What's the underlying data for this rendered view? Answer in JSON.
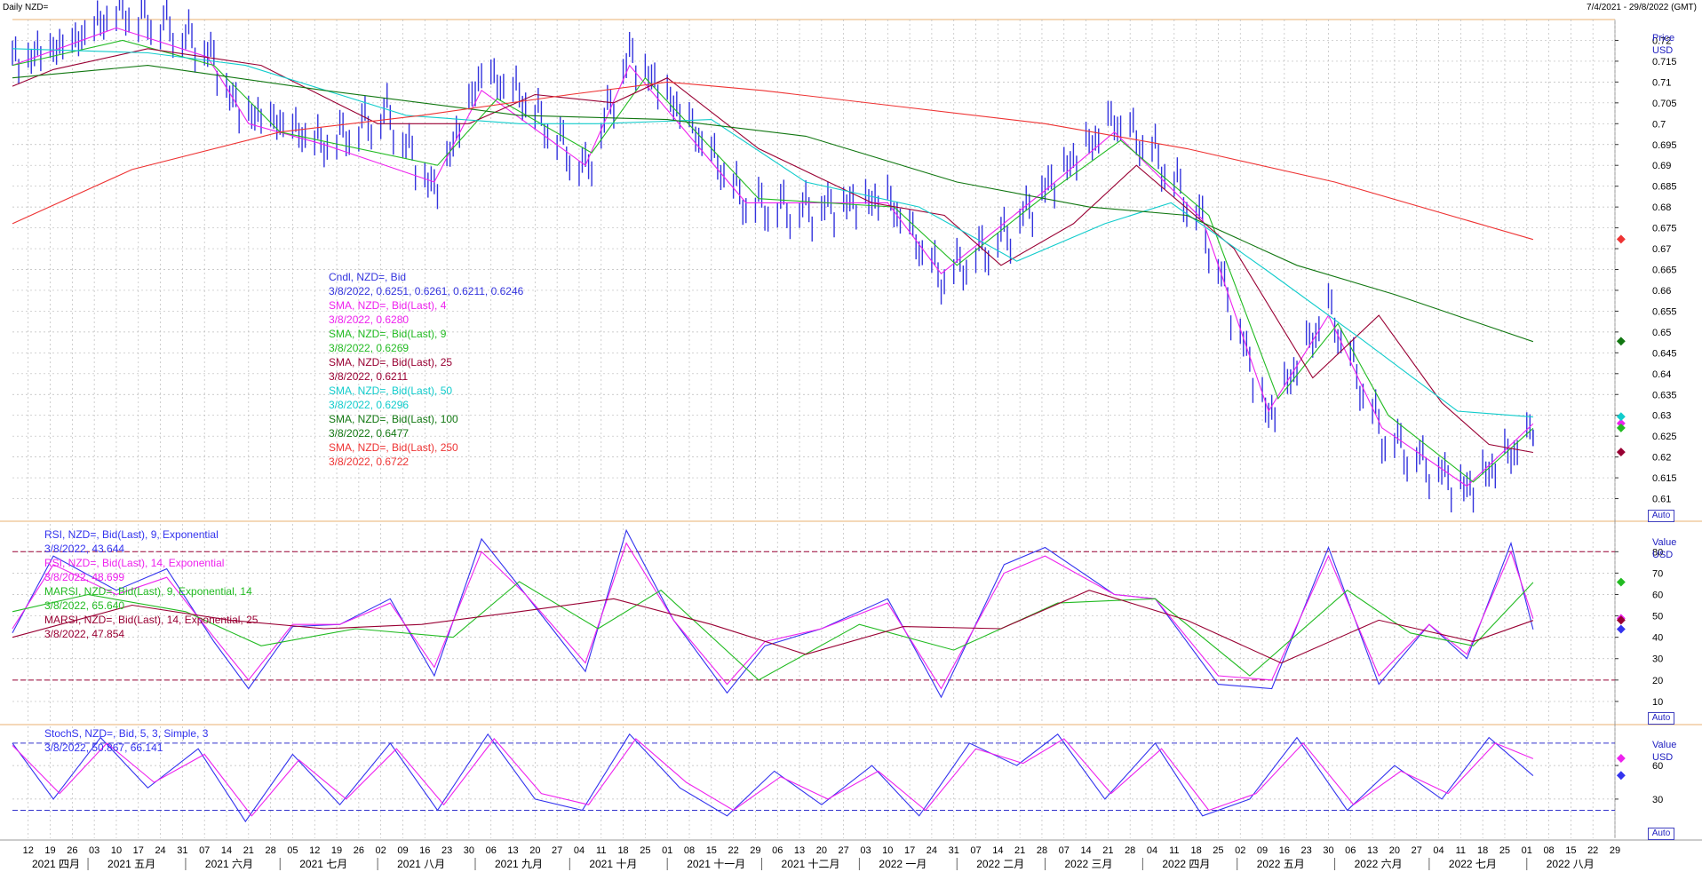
{
  "header": {
    "title": "Daily NZD=",
    "date_range": "7/4/2021 - 29/8/2022 (GMT)"
  },
  "colors": {
    "price": "#3333dd",
    "sma4": "#ee22ee",
    "sma9": "#22bb22",
    "sma25": "#990033",
    "sma50": "#11cccc",
    "sma100": "#117711",
    "sma250": "#ee3333",
    "rsi9": "#3333ee",
    "rsi14": "#ee22ee",
    "marsi9": "#22bb22",
    "marsi14": "#990033",
    "stoch_k": "#3333ee",
    "stoch_d": "#ee22ee",
    "grid": "#bbbbbb",
    "refline_rsi": "#990033",
    "refline_stoch": "#3333cc"
  },
  "main_panel": {
    "axis_title": "Price",
    "axis_unit": "USD",
    "auto_label": "Auto",
    "legend": [
      {
        "title": "Cndl, NZD=, Bid",
        "value": "3/8/2022, 0.6251, 0.6261, 0.6211, 0.6246",
        "color": "#3333dd"
      },
      {
        "title": "SMA, NZD=, Bid(Last),  4",
        "value": "3/8/2022, 0.6280",
        "color": "#ee22ee"
      },
      {
        "title": "SMA, NZD=, Bid(Last),  9",
        "value": "3/8/2022, 0.6269",
        "color": "#22bb22"
      },
      {
        "title": "SMA, NZD=, Bid(Last),  25",
        "value": "3/8/2022, 0.6211",
        "color": "#990033"
      },
      {
        "title": "SMA, NZD=, Bid(Last),  50",
        "value": "3/8/2022, 0.6296",
        "color": "#11cccc"
      },
      {
        "title": "SMA, NZD=, Bid(Last),  100",
        "value": "3/8/2022, 0.6477",
        "color": "#117711"
      },
      {
        "title": "SMA, NZD=, Bid(Last),  250",
        "value": "3/8/2022, 0.6722",
        "color": "#ee3333"
      }
    ]
  },
  "rsi_panel": {
    "axis_title": "Value",
    "axis_unit": "USD",
    "auto_label": "Auto",
    "legend": [
      {
        "title": "RSI, NZD=, Bid(Last),  9, Exponential",
        "value": "3/8/2022, 43.644",
        "color": "#3333ee"
      },
      {
        "title": "RSI, NZD=, Bid(Last),  14, Exponential",
        "value": "3/8/2022, 48.699",
        "color": "#ee22ee"
      },
      {
        "title": "MARSI, NZD=, Bid(Last),  9, Exponential, 14",
        "value": "3/8/2022, 65.640",
        "color": "#22bb22"
      },
      {
        "title": "MARSI, NZD=, Bid(Last),  14, Exponential, 25",
        "value": "3/8/2022, 47.854",
        "color": "#990033"
      }
    ]
  },
  "stoch_panel": {
    "axis_title": "Value",
    "axis_unit": "USD",
    "auto_label": "Auto",
    "legend": [
      {
        "title": "StochS, NZD=, Bid,  5, 3, Simple, 3",
        "value_a": "3/8/2022, 50.867",
        "value_b": "66.141",
        "color": "#3333ee"
      }
    ]
  },
  "chart_data": [
    {
      "type": "line",
      "panel": "price",
      "x_range": [
        "2021-04-07",
        "2022-08-29"
      ],
      "ylim": [
        0.605,
        0.725
      ],
      "y_ticks": [
        "0.72",
        "0.715",
        "0.71",
        "0.705",
        "0.7",
        "0.695",
        "0.69",
        "0.685",
        "0.68",
        "0.675",
        "0.67",
        "0.665",
        "0.66",
        "0.655",
        "0.65",
        "0.645",
        "0.64",
        "0.635",
        "0.63",
        "0.625",
        "0.62",
        "0.615",
        "0.61"
      ],
      "grid": true,
      "candles_key_points": {
        "x": [
          "2021-04-07",
          "2021-04-26",
          "2021-05-10",
          "2021-05-26",
          "2021-06-08",
          "2021-06-18",
          "2021-07-01",
          "2021-07-15",
          "2021-08-04",
          "2021-08-19",
          "2021-09-03",
          "2021-09-15",
          "2021-10-06",
          "2021-10-20",
          "2021-11-05",
          "2021-11-26",
          "2021-12-14",
          "2022-01-10",
          "2022-01-27",
          "2022-02-18",
          "2022-03-01",
          "2022-03-23",
          "2022-04-05",
          "2022-04-20",
          "2022-05-11",
          "2022-05-30",
          "2022-06-16",
          "2022-07-13",
          "2022-08-03"
        ],
        "y": [
          0.714,
          0.718,
          0.726,
          0.723,
          0.717,
          0.702,
          0.699,
          0.694,
          0.702,
          0.683,
          0.711,
          0.706,
          0.688,
          0.716,
          0.702,
          0.68,
          0.679,
          0.681,
          0.662,
          0.674,
          0.684,
          0.7,
          0.692,
          0.676,
          0.629,
          0.655,
          0.625,
          0.612,
          0.6246
        ]
      },
      "series": [
        {
          "name": "Cndl, NZD=, Bid",
          "values_key": "candles_key_points"
        },
        {
          "name": "SMA, NZD=, Bid(Last),  4",
          "x": [
            "2021-04-07",
            "2021-05-10",
            "2021-06-08",
            "2021-06-21",
            "2021-07-15",
            "2021-08-19",
            "2021-09-03",
            "2021-10-06",
            "2021-10-20",
            "2021-11-26",
            "2022-01-10",
            "2022-01-27",
            "2022-03-01",
            "2022-03-23",
            "2022-04-20",
            "2022-05-11",
            "2022-05-30",
            "2022-06-16",
            "2022-07-13",
            "2022-08-03"
          ],
          "y": [
            0.714,
            0.723,
            0.716,
            0.7,
            0.695,
            0.686,
            0.708,
            0.69,
            0.714,
            0.681,
            0.681,
            0.664,
            0.684,
            0.698,
            0.677,
            0.631,
            0.654,
            0.627,
            0.613,
            0.628
          ]
        },
        {
          "name": "SMA, NZD=, Bid(Last),  9",
          "x": [
            "2021-04-07",
            "2021-05-12",
            "2021-06-10",
            "2021-07-01",
            "2021-08-20",
            "2021-09-08",
            "2021-10-08",
            "2021-10-25",
            "2021-11-30",
            "2022-01-12",
            "2022-02-01",
            "2022-03-03",
            "2022-03-25",
            "2022-04-22",
            "2022-05-14",
            "2022-06-02",
            "2022-06-18",
            "2022-07-15",
            "2022-08-03"
          ],
          "y": [
            0.714,
            0.72,
            0.714,
            0.698,
            0.69,
            0.706,
            0.693,
            0.711,
            0.682,
            0.68,
            0.666,
            0.684,
            0.696,
            0.678,
            0.634,
            0.652,
            0.63,
            0.614,
            0.6269
          ]
        },
        {
          "name": "SMA, NZD=, Bid(Last),  25",
          "x": [
            "2021-04-07",
            "2021-04-20",
            "2021-05-20",
            "2021-06-25",
            "2021-08-01",
            "2021-08-30",
            "2021-09-20",
            "2021-10-15",
            "2021-11-01",
            "2021-11-30",
            "2022-01-05",
            "2022-01-28",
            "2022-02-15",
            "2022-03-10",
            "2022-03-30",
            "2022-04-30",
            "2022-05-25",
            "2022-06-15",
            "2022-07-05",
            "2022-07-20",
            "2022-08-03"
          ],
          "y": [
            0.709,
            0.713,
            0.718,
            0.714,
            0.7,
            0.7,
            0.707,
            0.705,
            0.711,
            0.694,
            0.681,
            0.678,
            0.666,
            0.676,
            0.69,
            0.67,
            0.639,
            0.654,
            0.633,
            0.623,
            0.6211
          ]
        },
        {
          "name": "SMA, NZD=, Bid(Last),  50",
          "x": [
            "2021-04-07",
            "2021-05-20",
            "2021-06-20",
            "2021-08-10",
            "2021-09-15",
            "2021-10-10",
            "2021-11-15",
            "2021-12-15",
            "2022-01-20",
            "2022-02-20",
            "2022-03-20",
            "2022-04-10",
            "2022-05-10",
            "2022-06-10",
            "2022-07-10",
            "2022-08-03"
          ],
          "y": [
            0.718,
            0.717,
            0.714,
            0.702,
            0.7,
            0.7,
            0.701,
            0.686,
            0.68,
            0.667,
            0.676,
            0.681,
            0.665,
            0.648,
            0.631,
            0.6296
          ]
        },
        {
          "name": "SMA, NZD=, Bid(Last),  100",
          "x": [
            "2021-04-07",
            "2021-05-20",
            "2021-07-15",
            "2021-09-15",
            "2021-11-01",
            "2021-12-15",
            "2022-02-01",
            "2022-03-15",
            "2022-04-15",
            "2022-05-20",
            "2022-06-20",
            "2022-08-03"
          ],
          "y": [
            0.711,
            0.714,
            0.708,
            0.702,
            0.701,
            0.697,
            0.686,
            0.68,
            0.678,
            0.666,
            0.659,
            0.6477
          ]
        },
        {
          "name": "SMA, NZD=, Bid(Last),  250",
          "x": [
            "2021-04-07",
            "2021-05-15",
            "2021-07-01",
            "2021-08-15",
            "2021-10-01",
            "2021-11-01",
            "2021-12-01",
            "2022-01-15",
            "2022-03-01",
            "2022-04-15",
            "2022-06-01",
            "2022-08-03"
          ],
          "y": [
            0.676,
            0.689,
            0.698,
            0.702,
            0.707,
            0.71,
            0.708,
            0.704,
            0.7,
            0.694,
            0.686,
            0.6722
          ]
        }
      ]
    },
    {
      "type": "line",
      "panel": "rsi",
      "x_range": [
        "2021-04-07",
        "2022-08-29"
      ],
      "ylim": [
        0,
        93
      ],
      "y_ticks": [
        "80",
        "70",
        "60",
        "50",
        "40",
        "30",
        "20",
        "10"
      ],
      "reference_lines": [
        80,
        20
      ],
      "series": [
        {
          "name": "RSI, NZD=, Bid(Last),  9, Exponential",
          "x": [
            "2021-04-07",
            "2021-04-20",
            "2021-05-10",
            "2021-05-26",
            "2021-06-10",
            "2021-06-21",
            "2021-07-05",
            "2021-07-20",
            "2021-08-05",
            "2021-08-19",
            "2021-09-03",
            "2021-09-17",
            "2021-10-06",
            "2021-10-19",
            "2021-11-03",
            "2021-11-20",
            "2021-12-02",
            "2021-12-20",
            "2022-01-10",
            "2022-01-27",
            "2022-02-16",
            "2022-03-01",
            "2022-03-23",
            "2022-04-05",
            "2022-04-25",
            "2022-05-12",
            "2022-05-30",
            "2022-06-15",
            "2022-07-01",
            "2022-07-13",
            "2022-07-27",
            "2022-08-03"
          ],
          "y": [
            42,
            78,
            62,
            72,
            38,
            16,
            45,
            46,
            58,
            22,
            86,
            60,
            24,
            90,
            48,
            14,
            36,
            44,
            58,
            12,
            74,
            82,
            60,
            58,
            18,
            16,
            82,
            18,
            46,
            30,
            84,
            43.644
          ]
        },
        {
          "name": "RSI, NZD=, Bid(Last),  14, Exponential",
          "x": [
            "2021-04-07",
            "2021-04-20",
            "2021-05-10",
            "2021-05-26",
            "2021-06-10",
            "2021-06-21",
            "2021-07-05",
            "2021-07-20",
            "2021-08-05",
            "2021-08-19",
            "2021-09-03",
            "2021-09-17",
            "2021-10-06",
            "2021-10-19",
            "2021-11-03",
            "2021-11-20",
            "2021-12-02",
            "2021-12-20",
            "2022-01-10",
            "2022-01-27",
            "2022-02-16",
            "2022-03-01",
            "2022-03-23",
            "2022-04-05",
            "2022-04-25",
            "2022-05-12",
            "2022-05-30",
            "2022-06-15",
            "2022-07-01",
            "2022-07-13",
            "2022-07-27",
            "2022-08-03"
          ],
          "y": [
            44,
            74,
            60,
            68,
            40,
            20,
            46,
            46,
            56,
            26,
            80,
            60,
            28,
            84,
            48,
            18,
            38,
            44,
            56,
            16,
            70,
            78,
            60,
            58,
            22,
            20,
            78,
            22,
            46,
            32,
            80,
            48.699
          ]
        },
        {
          "name": "MARSI, NZD=, Bid(Last),  9, Exponential, 14",
          "x": [
            "2021-04-07",
            "2021-05-01",
            "2021-06-01",
            "2021-06-25",
            "2021-07-25",
            "2021-08-25",
            "2021-09-15",
            "2021-10-10",
            "2021-10-30",
            "2021-11-30",
            "2022-01-01",
            "2022-01-31",
            "2022-03-05",
            "2022-04-05",
            "2022-05-05",
            "2022-06-05",
            "2022-06-25",
            "2022-07-15",
            "2022-08-03"
          ],
          "y": [
            52,
            60,
            52,
            36,
            44,
            40,
            66,
            44,
            62,
            20,
            46,
            34,
            56,
            58,
            22,
            62,
            42,
            36,
            65.64
          ]
        },
        {
          "name": "MARSI, NZD=, Bid(Last),  14, Exponential, 25",
          "x": [
            "2021-04-07",
            "2021-05-15",
            "2021-06-15",
            "2021-07-15",
            "2021-08-15",
            "2021-09-15",
            "2021-10-15",
            "2021-11-15",
            "2021-12-15",
            "2022-01-15",
            "2022-02-15",
            "2022-03-15",
            "2022-04-15",
            "2022-05-15",
            "2022-06-15",
            "2022-07-15",
            "2022-08-03"
          ],
          "y": [
            40,
            55,
            48,
            44,
            46,
            52,
            58,
            46,
            32,
            45,
            44,
            62,
            48,
            28,
            48,
            38,
            47.854
          ]
        }
      ]
    },
    {
      "type": "line",
      "panel": "stochastic",
      "x_range": [
        "2021-04-07",
        "2022-08-29"
      ],
      "ylim": [
        -5,
        95
      ],
      "y_ticks": [
        "60",
        "30"
      ],
      "reference_lines": [
        80,
        20
      ],
      "series": [
        {
          "name": "StochS %K",
          "x": [
            "2021-04-07",
            "2021-04-20",
            "2021-05-05",
            "2021-05-20",
            "2021-06-05",
            "2021-06-20",
            "2021-07-05",
            "2021-07-20",
            "2021-08-05",
            "2021-08-20",
            "2021-09-05",
            "2021-09-20",
            "2021-10-05",
            "2021-10-20",
            "2021-11-05",
            "2021-11-20",
            "2021-12-05",
            "2021-12-20",
            "2022-01-05",
            "2022-01-20",
            "2022-02-05",
            "2022-02-20",
            "2022-03-05",
            "2022-03-20",
            "2022-04-05",
            "2022-04-20",
            "2022-05-05",
            "2022-05-20",
            "2022-06-05",
            "2022-06-20",
            "2022-07-05",
            "2022-07-20",
            "2022-08-03"
          ],
          "y": [
            80,
            30,
            85,
            40,
            75,
            10,
            70,
            25,
            80,
            20,
            88,
            30,
            20,
            88,
            40,
            15,
            55,
            25,
            60,
            15,
            80,
            60,
            88,
            30,
            80,
            15,
            30,
            85,
            20,
            60,
            30,
            85,
            50.867
          ]
        },
        {
          "name": "StochS %D",
          "x": [
            "2021-04-07",
            "2021-04-22",
            "2021-05-07",
            "2021-05-22",
            "2021-06-07",
            "2021-06-22",
            "2021-07-07",
            "2021-07-22",
            "2021-08-07",
            "2021-08-22",
            "2021-09-07",
            "2021-09-22",
            "2021-10-07",
            "2021-10-22",
            "2021-11-07",
            "2021-11-22",
            "2021-12-07",
            "2021-12-22",
            "2022-01-07",
            "2022-01-22",
            "2022-02-07",
            "2022-02-22",
            "2022-03-07",
            "2022-03-22",
            "2022-04-07",
            "2022-04-22",
            "2022-05-07",
            "2022-05-22",
            "2022-06-07",
            "2022-06-22",
            "2022-07-07",
            "2022-07-22",
            "2022-08-03"
          ],
          "y": [
            78,
            35,
            80,
            45,
            70,
            15,
            65,
            30,
            75,
            25,
            84,
            35,
            25,
            84,
            45,
            20,
            50,
            30,
            55,
            20,
            75,
            62,
            84,
            35,
            75,
            20,
            35,
            80,
            25,
            55,
            35,
            80,
            66.141
          ]
        }
      ]
    }
  ],
  "x_axis": {
    "day_ticks": [
      "12",
      "19",
      "26",
      "03",
      "10",
      "17",
      "24",
      "31",
      "07",
      "14",
      "21",
      "28",
      "05",
      "12",
      "19",
      "26",
      "02",
      "09",
      "16",
      "23",
      "30",
      "06",
      "13",
      "20",
      "27",
      "04",
      "11",
      "18",
      "25",
      "01",
      "08",
      "15",
      "22",
      "29",
      "06",
      "13",
      "20",
      "27",
      "03",
      "10",
      "17",
      "24",
      "31",
      "07",
      "14",
      "21",
      "28",
      "07",
      "14",
      "21",
      "28",
      "04",
      "11",
      "18",
      "25",
      "02",
      "09",
      "16",
      "23",
      "30",
      "06",
      "13",
      "20",
      "27",
      "04",
      "11",
      "18",
      "25",
      "01",
      "08",
      "15",
      "22",
      "29"
    ],
    "month_labels": [
      "2021 四月",
      "2021 五月",
      "2021 六月",
      "2021 七月",
      "2021 八月",
      "2021 九月",
      "2021 十月",
      "2021 十一月",
      "2021 十二月",
      "2022 一月",
      "2022 二月",
      "2022 三月",
      "2022 四月",
      "2022 五月",
      "2022 六月",
      "2022 七月",
      "2022 八月"
    ]
  }
}
